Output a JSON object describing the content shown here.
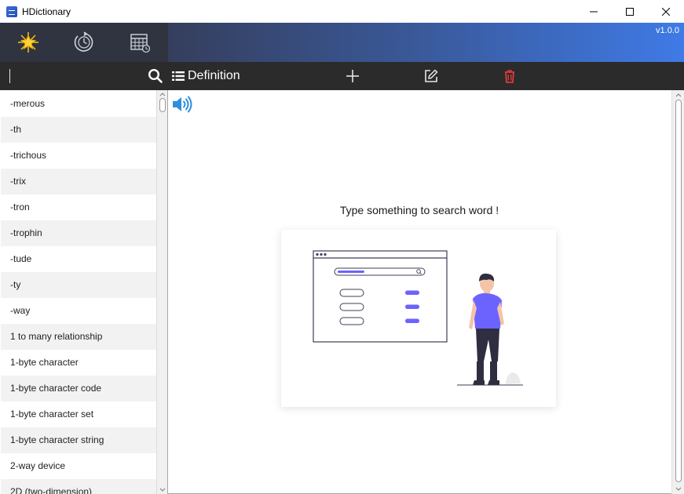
{
  "window": {
    "title": "HDictionary"
  },
  "nav": {
    "buttons": [
      {
        "icon": "star-icon"
      },
      {
        "icon": "history-clock-icon"
      },
      {
        "icon": "calendar-icon"
      }
    ],
    "version": "v1.0.0",
    "banner_colors": [
      "#353e5c",
      "#3f7ae6"
    ]
  },
  "toolbar": {
    "search_value": "",
    "definition_label": "Definition",
    "delete_color": "#e03a3a"
  },
  "word_list": [
    "-merous",
    "-th",
    "-trichous",
    "-trix",
    "-tron",
    "-trophin",
    "-tude",
    "-ty",
    "-way",
    "1 to many relationship",
    "1-byte character",
    "1-byte character code",
    "1-byte character set",
    "1-byte character string",
    "2-way device",
    "2D (two-dimension)"
  ],
  "content": {
    "hint": "Type something to search word !",
    "accent": "#6c63ff"
  }
}
